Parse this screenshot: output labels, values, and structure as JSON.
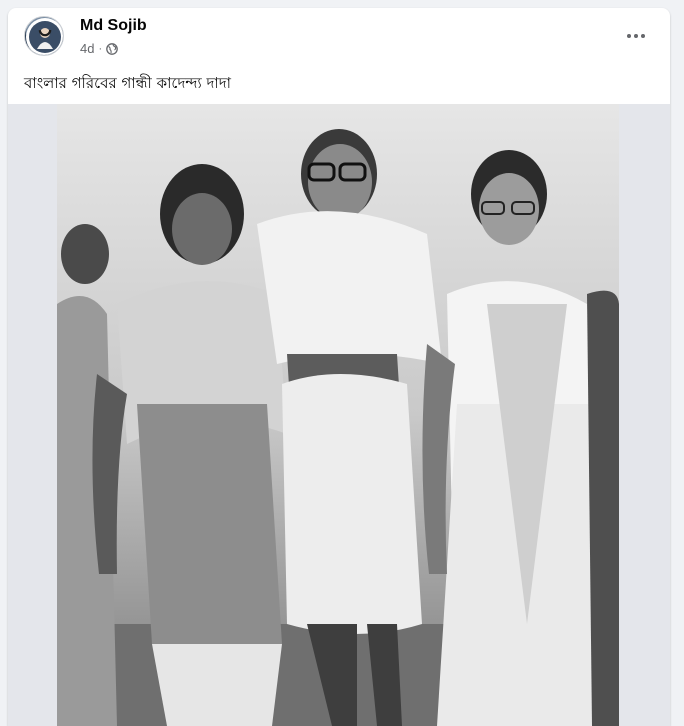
{
  "post": {
    "author": "Md Sojib",
    "time": "4d",
    "separator": "·",
    "text": "বাংলার গরিবের গান্ধী কাদেন্দ্য দাদা"
  },
  "icons": {
    "privacy": "globe-icon",
    "menu": "more-options-icon",
    "avatar": "profile-avatar"
  },
  "colors": {
    "name": "#050505",
    "meta": "#65676b",
    "background": "#f0f2f5",
    "photo_frame": "#e4e6eb"
  }
}
